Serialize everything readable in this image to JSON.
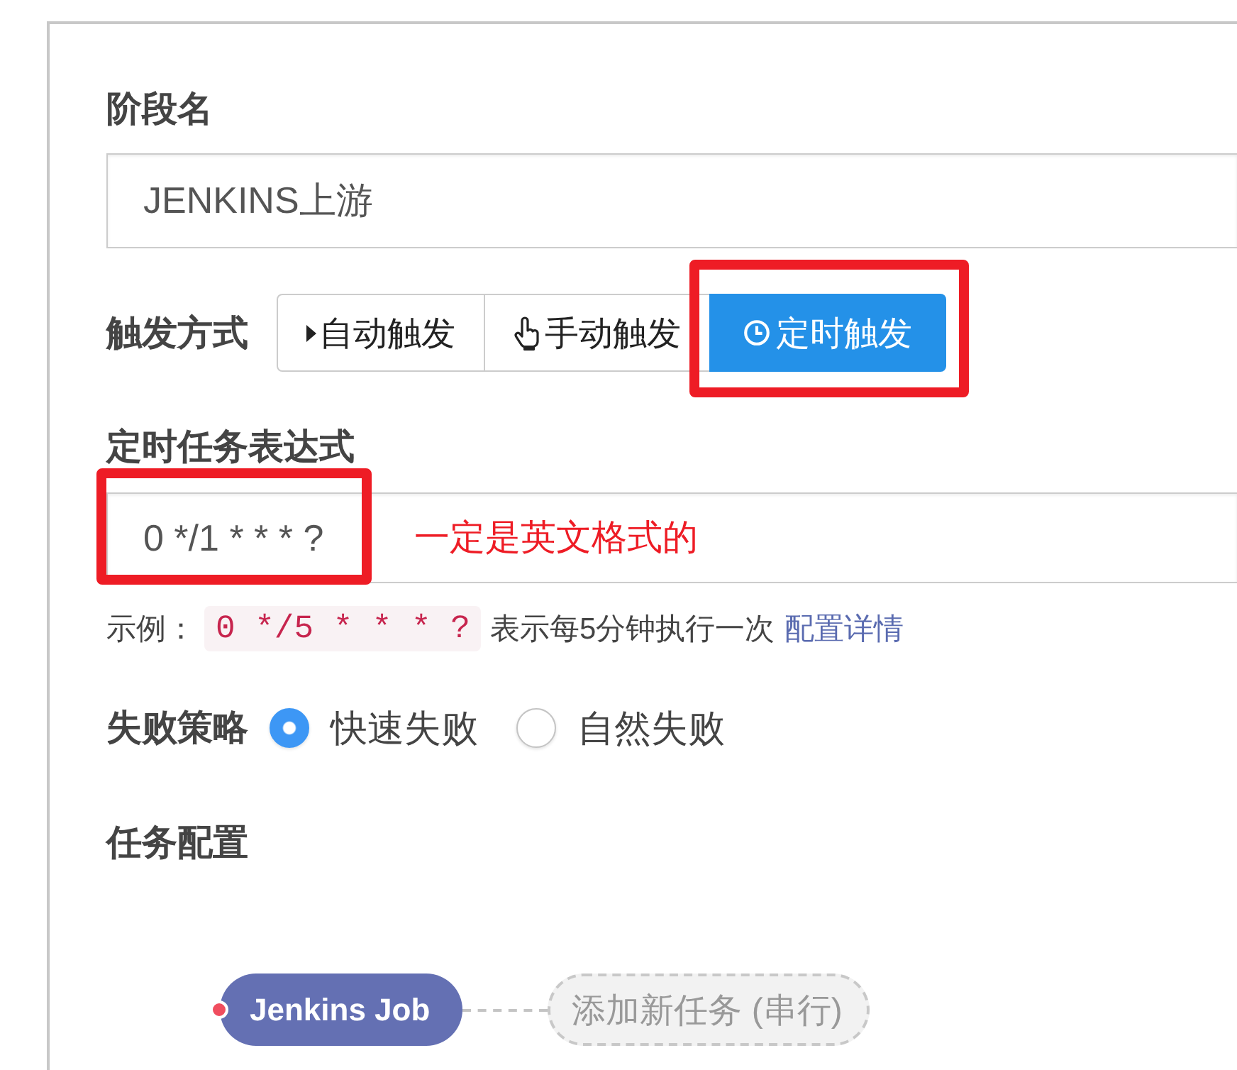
{
  "stage_name": {
    "label": "阶段名",
    "value": "JENKINS上游"
  },
  "trigger": {
    "label": "触发方式",
    "options": [
      {
        "kind": "auto",
        "label": "自动触发",
        "selected": false,
        "highlighted": false
      },
      {
        "kind": "manual",
        "label": "手动触发",
        "selected": false,
        "highlighted": false
      },
      {
        "kind": "timer",
        "label": "定时触发",
        "selected": true,
        "highlighted": true
      }
    ]
  },
  "cron": {
    "label": "定时任务表达式",
    "value": "0 */1 * * * ?",
    "highlighted": true,
    "note": "一定是英文格式的"
  },
  "help": {
    "prefix": "示例：",
    "code": "0 */5 * * * ?",
    "text": "表示每5分钟执行一次",
    "link": "配置详情"
  },
  "fail_strategy": {
    "label": "失败策略",
    "options": [
      {
        "label": "快速失败",
        "selected": true
      },
      {
        "label": "自然失败",
        "selected": false
      }
    ]
  },
  "tasks": {
    "label": "任务配置",
    "items": [
      {
        "kind": "job",
        "label": "Jenkins Job",
        "color": "#f04d5e"
      },
      {
        "kind": "add",
        "label": "添加新任务 (串行)"
      }
    ]
  }
}
